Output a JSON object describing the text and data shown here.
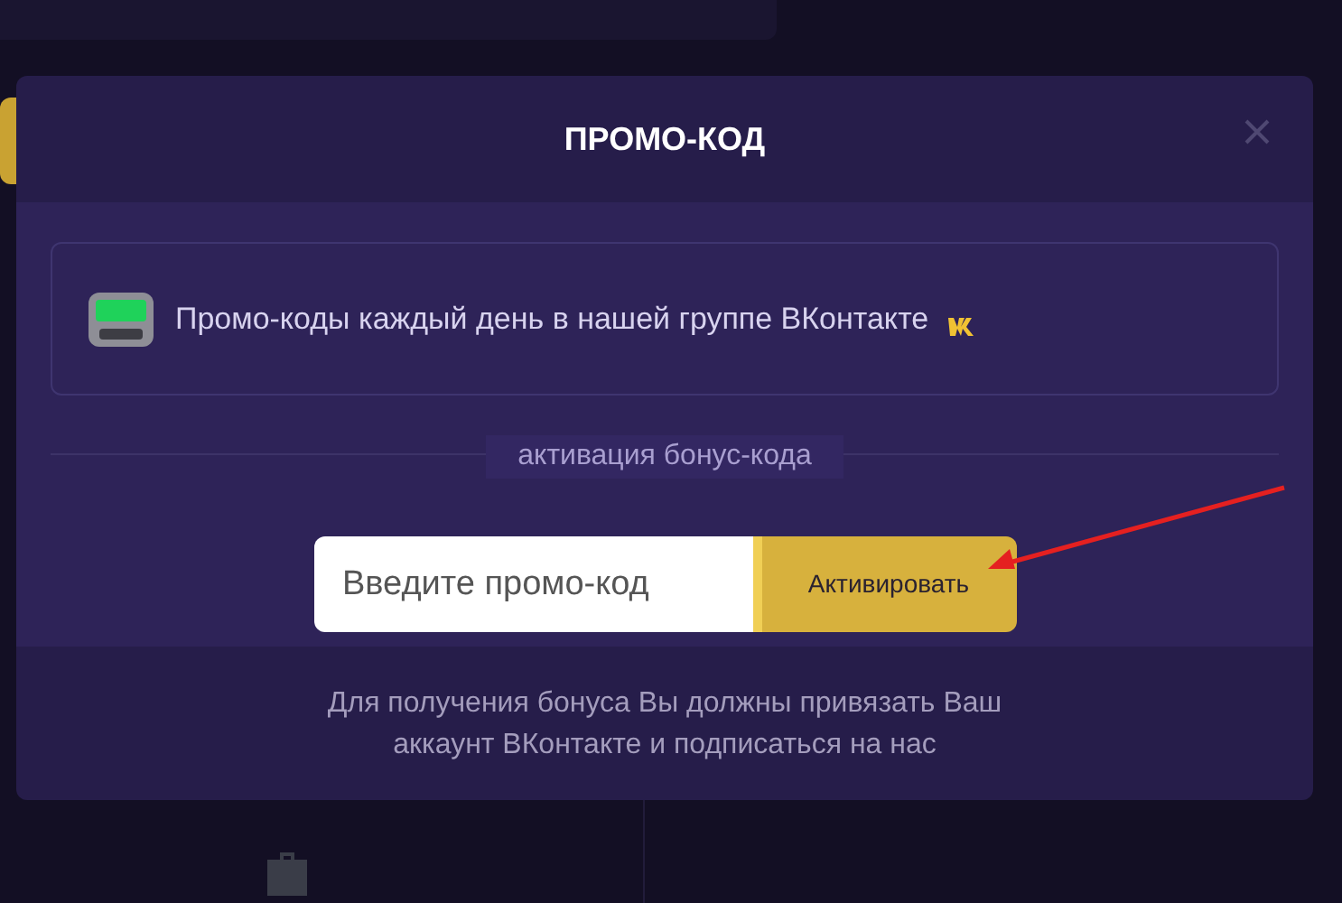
{
  "modal": {
    "title": "ПРОМО-КОД",
    "info": "Промо-коды каждый день в нашей группе ВКонтакте",
    "section_label": "активация бонус-кода",
    "promo_field": {
      "placeholder": "Введите промо-код"
    },
    "activate_button": "Активировать",
    "footer_note": "Для получения бонуса Вы должны привязать Ваш аккаунт ВКонтакте и подписаться на нас"
  }
}
